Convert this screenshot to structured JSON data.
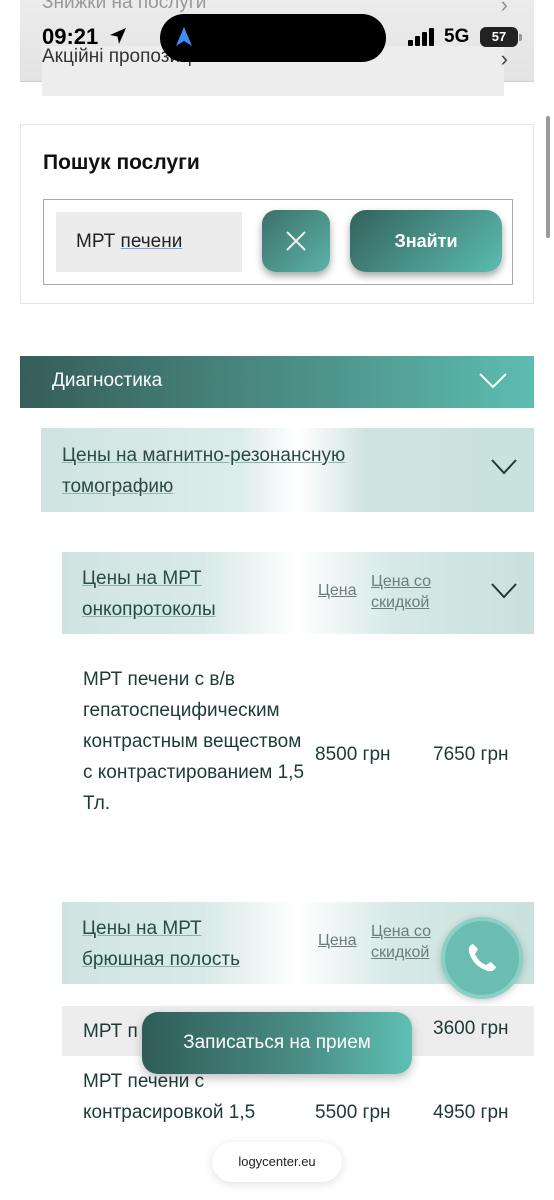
{
  "status_bar": {
    "time": "09:21",
    "network": "5G",
    "battery": "57"
  },
  "top_menu": {
    "item_discounts": "Знижки на послуги",
    "item_offers": "Акційні пропозиції"
  },
  "search": {
    "title": "Пошук послуги",
    "query_word1": "МРТ",
    "query_word2": "печени",
    "find_label": "Знайти"
  },
  "accordion": {
    "diagnostics_label": "Диагностика",
    "mri_prices_label": "Цены на магнитно-резонансную томографию",
    "oncoprotocols": {
      "label": "Цены на МРТ онкопротоколы",
      "price_header": "Цена",
      "discount_header": "Цена со скидкой",
      "items": [
        {
          "name": "МРТ печени с в/в гепатоспецифическим контрастным веществом с контрастированием 1,5 Тл.",
          "price": "8500 грн",
          "discount_price": "7650 грн"
        }
      ]
    },
    "abdominal": {
      "label": "Цены на МРТ брюшная полость",
      "price_header": "Цена",
      "discount_header": "Цена со скидкой",
      "items": [
        {
          "name": "МРТ п",
          "price": "",
          "discount_price": "3600 грн"
        },
        {
          "name": "МРТ печени с контрасировкой 1,5",
          "price": "5500 грн",
          "discount_price": "4950 грн"
        }
      ]
    }
  },
  "floating": {
    "book_label": "Записаться на прием",
    "url_text": "logycenter.eu",
    "call_icon": "phone-icon"
  },
  "colors": {
    "accent_dark": "#365d59",
    "accent_light": "#5dbdb0",
    "row_tint": "#cfe4e1"
  }
}
